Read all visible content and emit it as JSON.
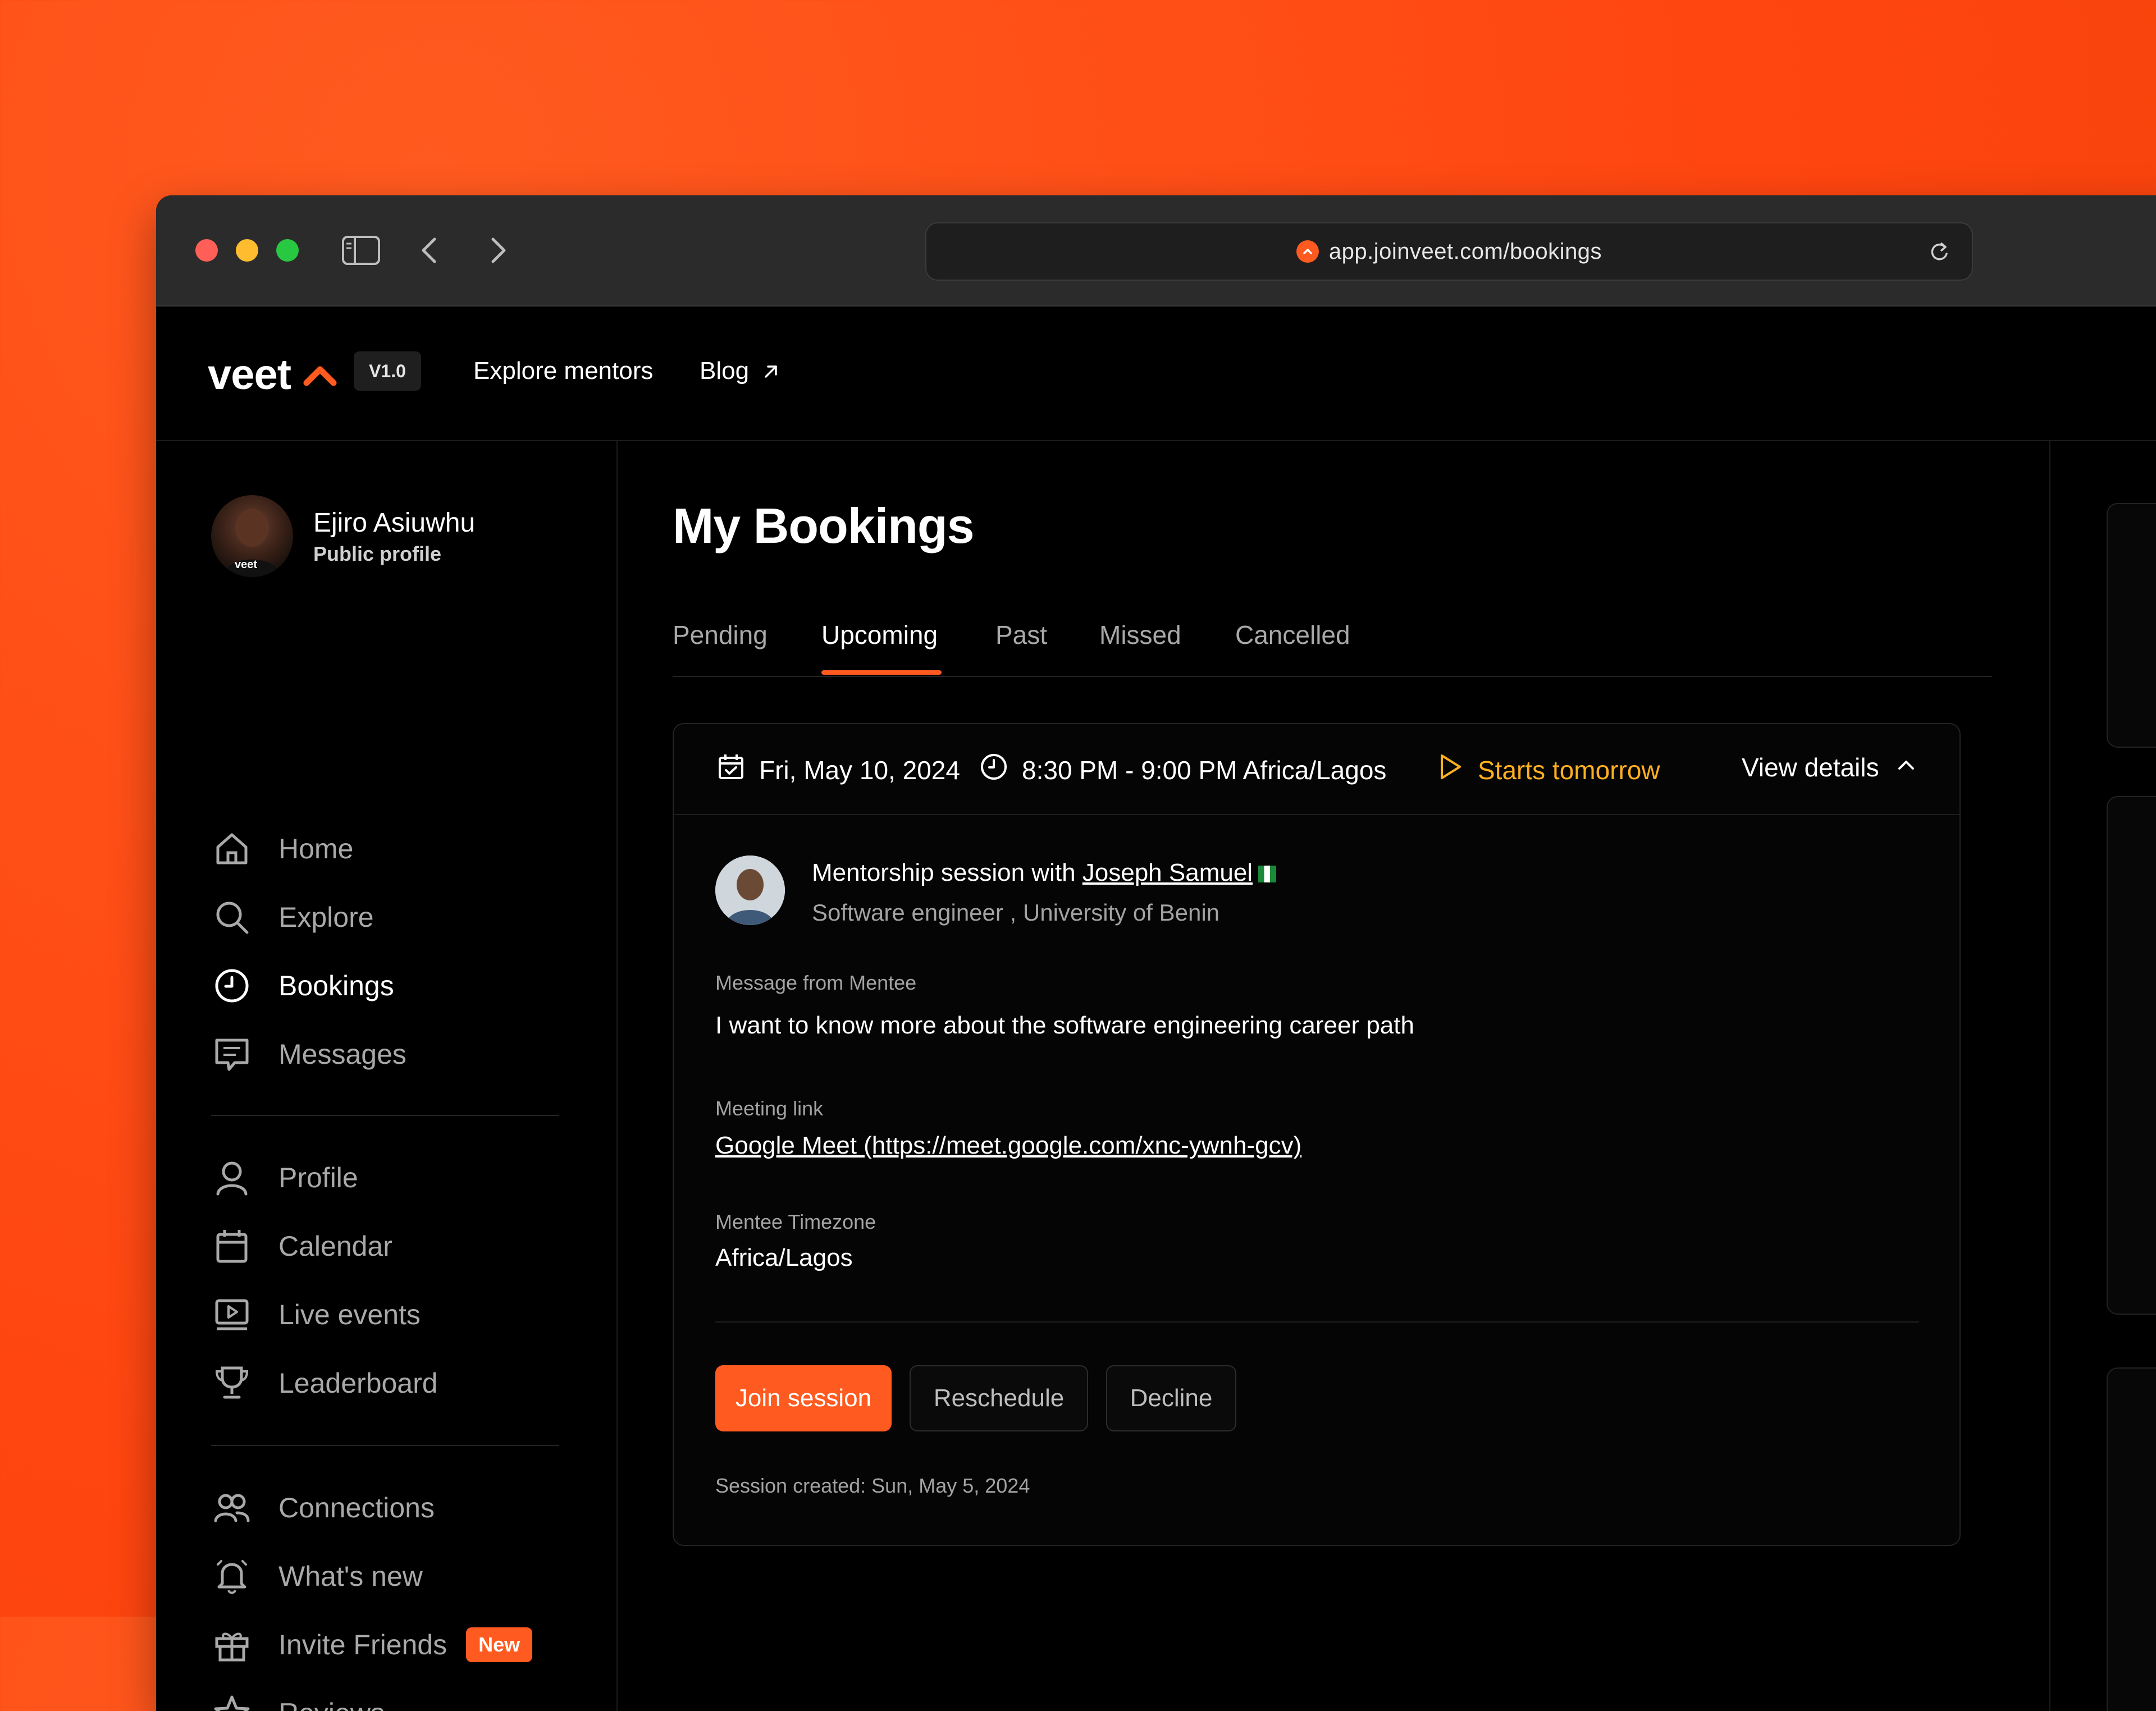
{
  "browser": {
    "url": "app.joinveet.com/bookings"
  },
  "topnav": {
    "logo": "veet",
    "version": "V1.0",
    "links": [
      "Explore mentors",
      "Blog"
    ]
  },
  "user": {
    "name": "Ejiro Asiuwhu",
    "subtitle": "Public profile",
    "avatar_tag": "veet"
  },
  "sidebar": {
    "group1": [
      {
        "label": "Home",
        "icon": "home-icon"
      },
      {
        "label": "Explore",
        "icon": "search-icon"
      },
      {
        "label": "Bookings",
        "icon": "clock-icon",
        "active": true
      },
      {
        "label": "Messages",
        "icon": "message-icon"
      }
    ],
    "group2": [
      {
        "label": "Profile",
        "icon": "user-icon"
      },
      {
        "label": "Calendar",
        "icon": "calendar-icon"
      },
      {
        "label": "Live events",
        "icon": "monitor-play-icon"
      },
      {
        "label": "Leaderboard",
        "icon": "trophy-icon"
      }
    ],
    "group3": [
      {
        "label": "Connections",
        "icon": "users-icon"
      },
      {
        "label": "What's new",
        "icon": "bell-icon"
      },
      {
        "label": "Invite Friends",
        "icon": "gift-icon",
        "badge": "New"
      },
      {
        "label": "Reviews",
        "icon": "star-icon"
      }
    ]
  },
  "main": {
    "title": "My Bookings",
    "tabs": [
      "Pending",
      "Upcoming",
      "Past",
      "Missed",
      "Cancelled"
    ],
    "active_tab": "Upcoming"
  },
  "booking": {
    "date": "Fri, May 10, 2024",
    "time": "8:30 PM - 9:00 PM Africa/Lagos",
    "status": "Starts tomorrow",
    "details_toggle": "View details",
    "session_prefix": "Mentorship session with ",
    "mentee_name": "Joseph Samuel",
    "mentee_subtitle": "Software engineer , University of Benin",
    "message_label": "Message from Mentee",
    "message": "I want to know more about the software engineering career path",
    "meeting_label": "Meeting link",
    "meeting_link": "Google Meet (https://meet.google.com/xnc-ywnh-gcv)",
    "timezone_label": "Mentee Timezone",
    "timezone": "Africa/Lagos",
    "actions": {
      "join": "Join session",
      "reschedule": "Reschedule",
      "decline": "Decline"
    },
    "created": "Session created: Sun, May 5, 2024"
  },
  "colors": {
    "accent": "#ff5a1f",
    "status": "#ffb01f",
    "background": "#000000"
  }
}
